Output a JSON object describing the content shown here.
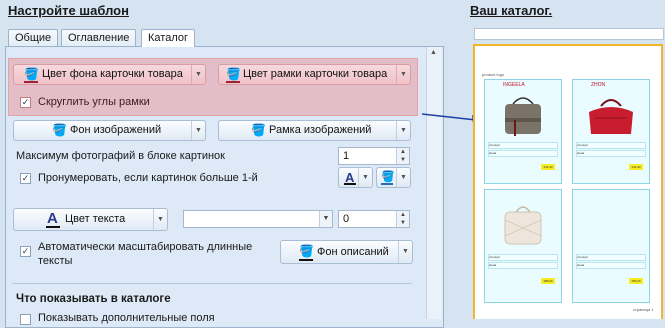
{
  "left_title": "Настройте шаблон",
  "right_title": "Ваш каталог.",
  "tabs": [
    {
      "label": "Общие"
    },
    {
      "label": "Оглавление"
    },
    {
      "label": "Каталог"
    }
  ],
  "card_bg_button": "Цвет фона карточки товара",
  "card_border_button": "Цвет рамки карточки товара",
  "round_corners": {
    "label": "Скруглить углы рамки",
    "checked": true
  },
  "image_bg_button": "Фон изображений",
  "image_border_button": "Рамка изображений",
  "max_photos": {
    "label": "Максимум фотографий в блоке картинок",
    "value": "1"
  },
  "numerate": {
    "label": "Пронумеровать, если картинок больше 1-й",
    "checked": true
  },
  "text_color_button": "Цвет текста",
  "font_select": {
    "value": ""
  },
  "font_size": {
    "value": "0"
  },
  "autoscale": {
    "label": "Автоматически масштабировать длинные тексты",
    "checked": true
  },
  "desc_bg_button": "Фон описаний",
  "section_heading": "Что показывать в каталоге",
  "partial_checkbox_label": "Показывать дополнительные поля",
  "colors": {
    "highlight": "#e89aa2",
    "arrow": "#1f3fa8",
    "catalog_border": "#f3b52a",
    "card_bg": "#eafcff",
    "price_bg": "#f6ee24"
  },
  "preview": {
    "header_text": "product logo",
    "products": [
      {
        "brand": "INGEELA",
        "price": "332,00",
        "field1": "Артикул",
        "field2": "Цена"
      },
      {
        "brand": "ZHON",
        "price": "344,00",
        "field1": "Артикул",
        "field2": "Цена"
      },
      {
        "brand": "",
        "price": "388,00",
        "field1": "Артикул",
        "field2": "Цена"
      },
      {
        "brand": "",
        "price": "356,00",
        "field1": "Артикул",
        "field2": "Цена"
      }
    ],
    "footer_text": "страница 1"
  }
}
